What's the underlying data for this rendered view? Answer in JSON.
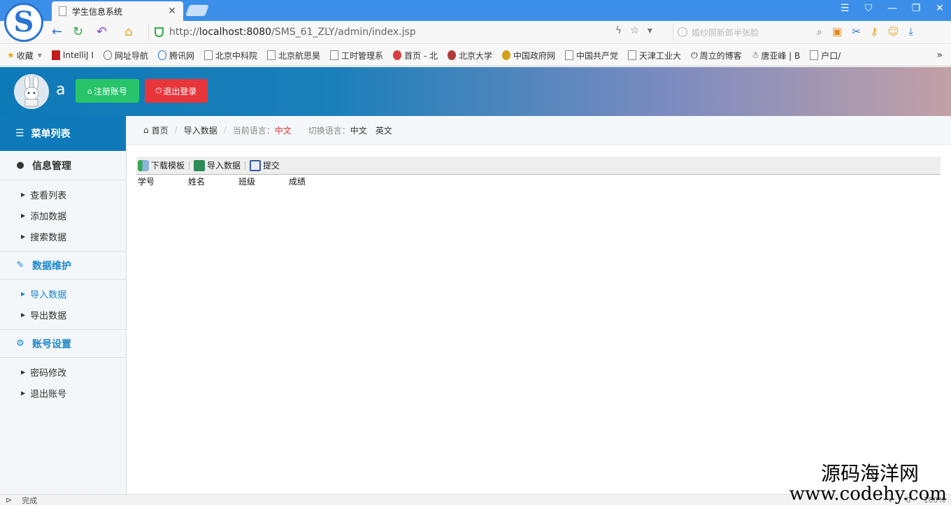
{
  "browser": {
    "tab_title": "学生信息系统",
    "url_prefix": "http://",
    "url_host": "localhost:8080",
    "url_path": "/SMS_61_ZLY/admin/index.jsp",
    "search_placeholder": "婚纱照新郎半张脸",
    "bookmarks": [
      {
        "label": "收藏",
        "icon": "star-icon"
      },
      {
        "label": "IntelliJ I",
        "icon": "intellij-icon"
      },
      {
        "label": "网址导航",
        "icon": "globe-icon"
      },
      {
        "label": "腾讯网",
        "icon": "tencent-icon"
      },
      {
        "label": "北京中科院",
        "icon": "page-icon"
      },
      {
        "label": "北京航思昊",
        "icon": "page-icon"
      },
      {
        "label": "工时管理系",
        "icon": "page-icon"
      },
      {
        "label": "首页 - 北",
        "icon": "site-icon"
      },
      {
        "label": "北京大学",
        "icon": "site-icon"
      },
      {
        "label": "中国政府网",
        "icon": "emblem-icon"
      },
      {
        "label": "中国共产党",
        "icon": "page-icon"
      },
      {
        "label": "天津工业大",
        "icon": "page-icon"
      },
      {
        "label": "周立的博客",
        "icon": "power-icon"
      },
      {
        "label": "唐亚峰 | B",
        "icon": "person-icon"
      },
      {
        "label": "户口/",
        "icon": "page-icon"
      }
    ],
    "status_text": "完成",
    "status_right": [
      "0",
      "100%"
    ]
  },
  "header": {
    "username": "a",
    "register_label": "注册账号",
    "logout_label": "退出登录"
  },
  "sidebar": {
    "title": "菜单列表",
    "groups": [
      {
        "label": "信息管理",
        "items": [
          "查看列表",
          "添加数据",
          "搜索数据"
        ]
      },
      {
        "label": "数据维护",
        "items": [
          "导入数据",
          "导出数据"
        ]
      },
      {
        "label": "账号设置",
        "items": [
          "密码修改",
          "退出账号"
        ]
      }
    ]
  },
  "breadcrumb": {
    "home": "首页",
    "current": "导入数据",
    "lang_label": "当前语言：",
    "lang_value": "中文",
    "switch_label": "切换语言：",
    "lang_cn": "中文",
    "lang_en": "英文"
  },
  "toolbar": {
    "download_template": "下载模板",
    "import_data": "导入数据",
    "submit": "提交"
  },
  "table": {
    "columns": [
      "学号",
      "姓名",
      "班级",
      "成绩"
    ]
  },
  "watermark": {
    "line1": "源码海洋网",
    "line2": "www.codehy.com"
  }
}
